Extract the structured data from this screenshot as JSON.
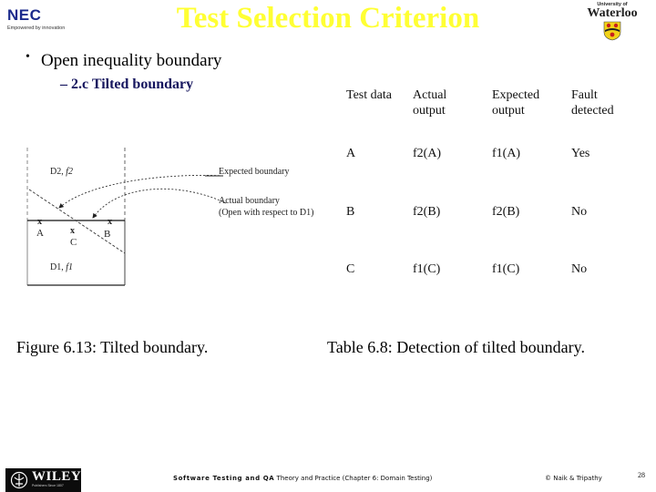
{
  "header": {
    "title": "Test Selection Criterion",
    "nec_logo": {
      "name": "NEC",
      "tagline": "Empowered by innovation"
    },
    "uw_logo": {
      "small_text": "University of",
      "big_text": "Waterloo"
    }
  },
  "content": {
    "bullet": "Open inequality boundary",
    "bullet_marker": "•",
    "sub_bullet": "– 2.c Tilted boundary"
  },
  "figure": {
    "caption": "Figure 6.13: Tilted boundary.",
    "region_top": "D2,",
    "region_top_fn": "f2",
    "region_bottom": "D1,",
    "region_bottom_fn": "f1",
    "points": {
      "A": "A",
      "B": "B",
      "C": "C"
    },
    "point_marker": "x",
    "expected_label": "Expected boundary",
    "actual_label_line1": "Actual boundary",
    "actual_label_line2": "(Open with respect to D1)"
  },
  "table": {
    "caption": "Table 6.8: Detection of tilted boundary.",
    "headers": [
      {
        "line1": "Test data",
        "line2": ""
      },
      {
        "line1": "Actual",
        "line2": "output"
      },
      {
        "line1": "Expected",
        "line2": "output"
      },
      {
        "line1": "Fault",
        "line2": "detected"
      }
    ],
    "rows": [
      [
        "A",
        "f2(A)",
        "f1(A)",
        "Yes"
      ],
      [
        "B",
        "f2(B)",
        "f2(B)",
        "No"
      ],
      [
        "C",
        "f1(C)",
        "f1(C)",
        "No"
      ]
    ]
  },
  "footer": {
    "publisher": "WILEY",
    "publisher_sub": "Publishers Since 1807",
    "book_title_bold": "Software Testing and QA",
    "book_title_rest": " Theory and Practice (Chapter 6: Domain Testing)",
    "authors": "© Naik & Tripathy",
    "page_number": "28"
  },
  "colors": {
    "title": "#ffff33",
    "sub_bullet": "#15155e",
    "nec_blue": "#1b2a8c"
  }
}
